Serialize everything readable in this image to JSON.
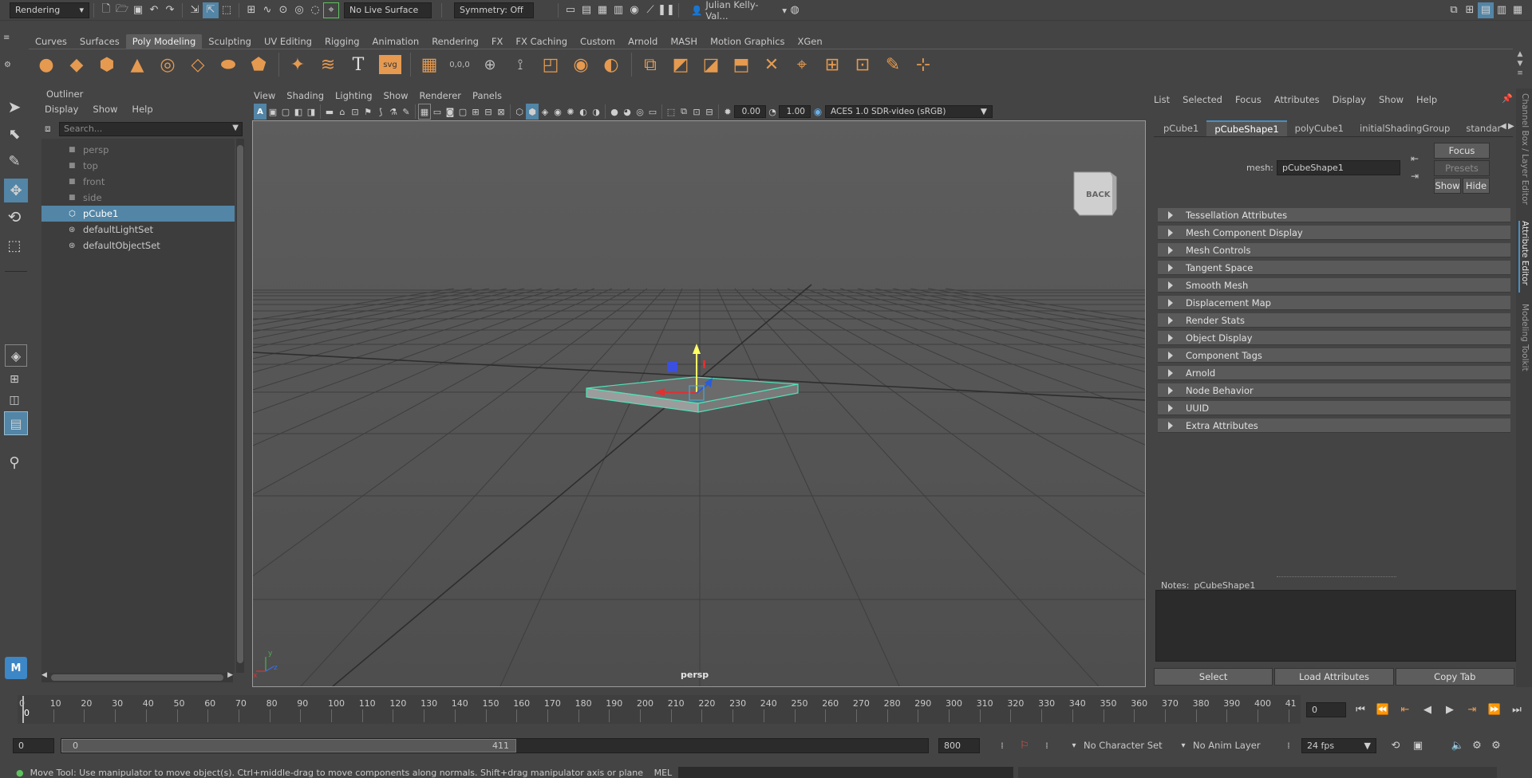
{
  "status_line": {
    "menu_set": "Rendering",
    "live_surface": "No Live Surface",
    "symmetry": "Symmetry: Off",
    "user": "Julian Kelly-Val..."
  },
  "shelf": {
    "tabs": [
      "Curves",
      "Surfaces",
      "Poly Modeling",
      "Sculpting",
      "UV Editing",
      "Rigging",
      "Animation",
      "Rendering",
      "FX",
      "FX Caching",
      "Custom",
      "Arnold",
      "MASH",
      "Motion Graphics",
      "XGen"
    ],
    "active_index": 2,
    "icons": [
      "sphere-icon",
      "cube-icon",
      "cylinder-icon",
      "cone-icon",
      "torus-icon",
      "plane-icon",
      "disc-icon",
      "platonic-icon",
      "super-shape-icon",
      "sweep-mesh-icon",
      "type-icon",
      "svg-icon",
      "combine-icon",
      "separate-icon",
      "smooth-icon",
      "boolean-icon",
      "mirror-icon",
      "bevel-icon",
      "extrude-icon",
      "bridge-icon",
      "multi-cut-icon",
      "target-weld-icon",
      "merge-icon",
      "fill-hole-icon",
      "sculpt-icon",
      "quad-draw-icon"
    ],
    "text_icon_glyphs": {
      "type": "T",
      "svg": "svg",
      "poly_count": "0,0,0"
    }
  },
  "outliner": {
    "title": "Outliner",
    "menus": [
      "Display",
      "Show",
      "Help"
    ],
    "search_placeholder": "Search...",
    "items": [
      {
        "label": "persp",
        "kind": "camera",
        "dim": true
      },
      {
        "label": "top",
        "kind": "camera",
        "dim": true
      },
      {
        "label": "front",
        "kind": "camera",
        "dim": true
      },
      {
        "label": "side",
        "kind": "camera",
        "dim": true
      },
      {
        "label": "pCube1",
        "kind": "mesh",
        "selected": true
      },
      {
        "label": "defaultLightSet",
        "kind": "set"
      },
      {
        "label": "defaultObjectSet",
        "kind": "set"
      }
    ]
  },
  "viewport": {
    "menus": [
      "View",
      "Shading",
      "Lighting",
      "Show",
      "Renderer",
      "Panels"
    ],
    "exposure": "0.00",
    "gamma": "1.00",
    "color_space": "ACES 1.0 SDR-video (sRGB)",
    "camera_label": "persp",
    "view_cube_label": "BACK",
    "axis_labels": {
      "x": "x",
      "y": "y",
      "z": "z"
    }
  },
  "attribute_editor": {
    "menus": [
      "List",
      "Selected",
      "Focus",
      "Attributes",
      "Display",
      "Show",
      "Help"
    ],
    "tabs": [
      "pCube1",
      "pCubeShape1",
      "polyCube1",
      "initialShadingGroup",
      "standar"
    ],
    "active_tab": 1,
    "mesh_label": "mesh:",
    "mesh_value": "pCubeShape1",
    "focus_btn": "Focus",
    "presets_btn": "Presets",
    "show_btn": "Show",
    "hide_btn": "Hide",
    "sections": [
      "Tessellation Attributes",
      "Mesh Component Display",
      "Mesh Controls",
      "Tangent Space",
      "Smooth Mesh",
      "Displacement Map",
      "Render Stats",
      "Object Display",
      "Component Tags",
      "Arnold",
      "Node Behavior",
      "UUID",
      "Extra Attributes"
    ],
    "notes_label": "Notes:",
    "notes_node": "pCubeShape1",
    "bottom_buttons": [
      "Select",
      "Load Attributes",
      "Copy Tab"
    ],
    "side_tabs": [
      "Channel Box / Layer Editor",
      "Attribute Editor",
      "Modeling Toolkit"
    ]
  },
  "timeline": {
    "ticks": [
      "0",
      "10",
      "20",
      "30",
      "40",
      "50",
      "60",
      "70",
      "80",
      "90",
      "100",
      "110",
      "120",
      "130",
      "140",
      "150",
      "160",
      "170",
      "180",
      "190",
      "200",
      "210",
      "220",
      "230",
      "240",
      "250",
      "260",
      "270",
      "280",
      "290",
      "300",
      "310",
      "320",
      "330",
      "340",
      "350",
      "360",
      "370",
      "380",
      "390",
      "400",
      "41"
    ],
    "current_frame_marker": "0",
    "current_frame": "0"
  },
  "range_slider": {
    "start": "0",
    "range_start": "0",
    "range_end": "411",
    "end": "800",
    "character_set": "No Character Set",
    "anim_layer": "No Anim Layer",
    "fps": "24 fps"
  },
  "help_line": {
    "text": "Move Tool: Use manipulator to move object(s). Ctrl+middle-drag to move components along normals. Shift+drag manipulator axis or plane handles to extrude components or c",
    "lang": "MEL"
  },
  "colors": {
    "accent": "#4a8ec2",
    "selection": "#5285a6",
    "wireframe_sel": "#4fe3b8",
    "shelf_icon": "#e59a50"
  }
}
